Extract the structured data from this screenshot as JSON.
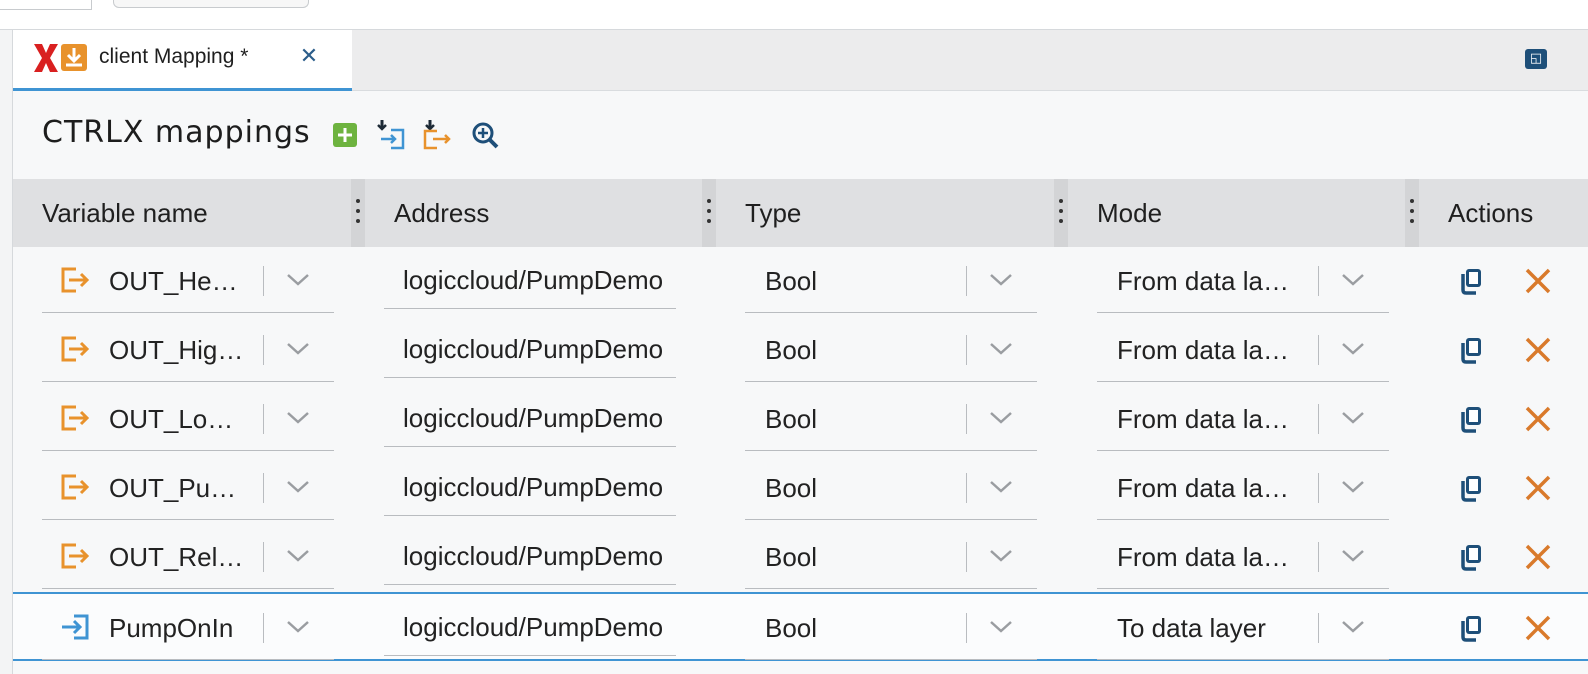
{
  "tab": {
    "title": "client Mapping *",
    "close_icon": "close-icon"
  },
  "panel": {
    "maximize_icon": "maximize-icon"
  },
  "heading": {
    "title": "CTRLX mappings"
  },
  "toolbar": {
    "add_icon": "add-icon",
    "import_icon": "import-icon",
    "export_icon": "export-icon",
    "browse_icon": "search-plus-icon"
  },
  "columns": [
    "Variable name",
    "Address",
    "Type",
    "Mode",
    "Actions"
  ],
  "rows": [
    {
      "direction": "out",
      "name": "OUT_He…",
      "address": "logiccloud/PumpDemo",
      "type": "Bool",
      "mode": "From data la…"
    },
    {
      "direction": "out",
      "name": "OUT_Hig…",
      "address": "logiccloud/PumpDemo",
      "type": "Bool",
      "mode": "From data la…"
    },
    {
      "direction": "out",
      "name": "OUT_Lo…",
      "address": "logiccloud/PumpDemo",
      "type": "Bool",
      "mode": "From data la…"
    },
    {
      "direction": "out",
      "name": "OUT_Pu…",
      "address": "logiccloud/PumpDemo",
      "type": "Bool",
      "mode": "From data la…"
    },
    {
      "direction": "out",
      "name": "OUT_Rel…",
      "address": "logiccloud/PumpDemo",
      "type": "Bool",
      "mode": "From data la…"
    },
    {
      "direction": "in",
      "name": "PumpOnIn",
      "address": "logiccloud/PumpDemo",
      "type": "Bool",
      "mode": "To data layer"
    }
  ],
  "colors": {
    "accent": "#3f94d3",
    "orange": "#e8922c",
    "navy": "#1e4f79",
    "green": "#6db33f",
    "red": "#d92020"
  }
}
